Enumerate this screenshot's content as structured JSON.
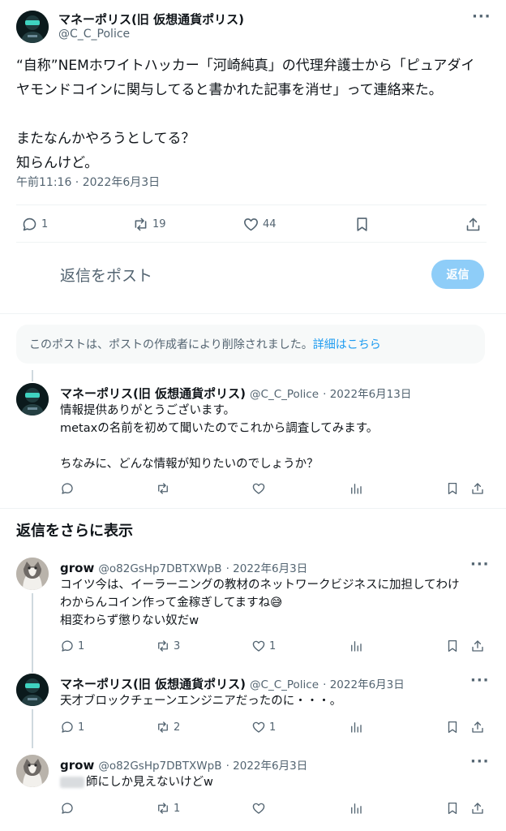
{
  "main_post": {
    "display_name": "マネーポリス(旧 仮想通貨ポリス)",
    "handle": "@C_C_Police",
    "text_lines": [
      "“自称”NEMホワイトハッカー「河崎純真」の代理弁護士から「ピュアダイ",
      "ヤモンドコインに関与してると書かれた記事を消せ」って連絡来た。",
      "",
      "またなんかやろうとしてる？",
      "知らんけど。"
    ],
    "timestamp": "午前11:16 · 2022年6月3日",
    "stats": {
      "replies": "1",
      "reposts": "19",
      "likes": "44"
    }
  },
  "reply_box": {
    "placeholder": "返信をポスト",
    "button_label": "返信"
  },
  "deleted_notice": {
    "text": "このポストは、ポストの作成者により削除されました。",
    "link": "詳細はこちら"
  },
  "replies": [
    {
      "display_name": "マネーポリス(旧 仮想通貨ポリス)",
      "handle": "@C_C_Police",
      "date": "· 2022年6月13日",
      "lines": [
        "情報提供ありがとうございます。",
        "metaxの名前を初めて聞いたのでこれから調査してみます。",
        "",
        "ちなみに、どんな情報が知りたいのでしょうか？"
      ]
    }
  ],
  "more_replies_heading": "返信をさらに表示",
  "thread": [
    {
      "display_name": "grow",
      "handle": "@o82GsHp7DBTXWpB",
      "date": "· 2022年6月3日",
      "lines": [
        "コイツ今は、イーラーニングの教材のネットワークビジネスに加担してわけ",
        "わからんコイン作って金稼ぎしてますね😅",
        "相変わらず懲りない奴だw"
      ],
      "stats": {
        "replies": "1",
        "reposts": "3",
        "likes": "1"
      }
    },
    {
      "display_name": "マネーポリス(旧 仮想通貨ポリス)",
      "handle": "@C_C_Police",
      "date": "· 2022年6月3日",
      "lines": [
        "天才ブロックチェーンエンジニアだったのに・・・。"
      ],
      "stats": {
        "replies": "1",
        "reposts": "2",
        "likes": "1"
      }
    },
    {
      "display_name": "grow",
      "handle": "@o82GsHp7DBTXWpB",
      "date": "· 2022年6月3日",
      "lines": [
        "師にしか見えないけどw"
      ],
      "stats": {
        "replies": "",
        "reposts": "1",
        "likes": ""
      }
    }
  ],
  "colors": {
    "accent": "#1d9bf0",
    "reply_button_disabled": "#8ecdf8",
    "muted": "#536471"
  }
}
